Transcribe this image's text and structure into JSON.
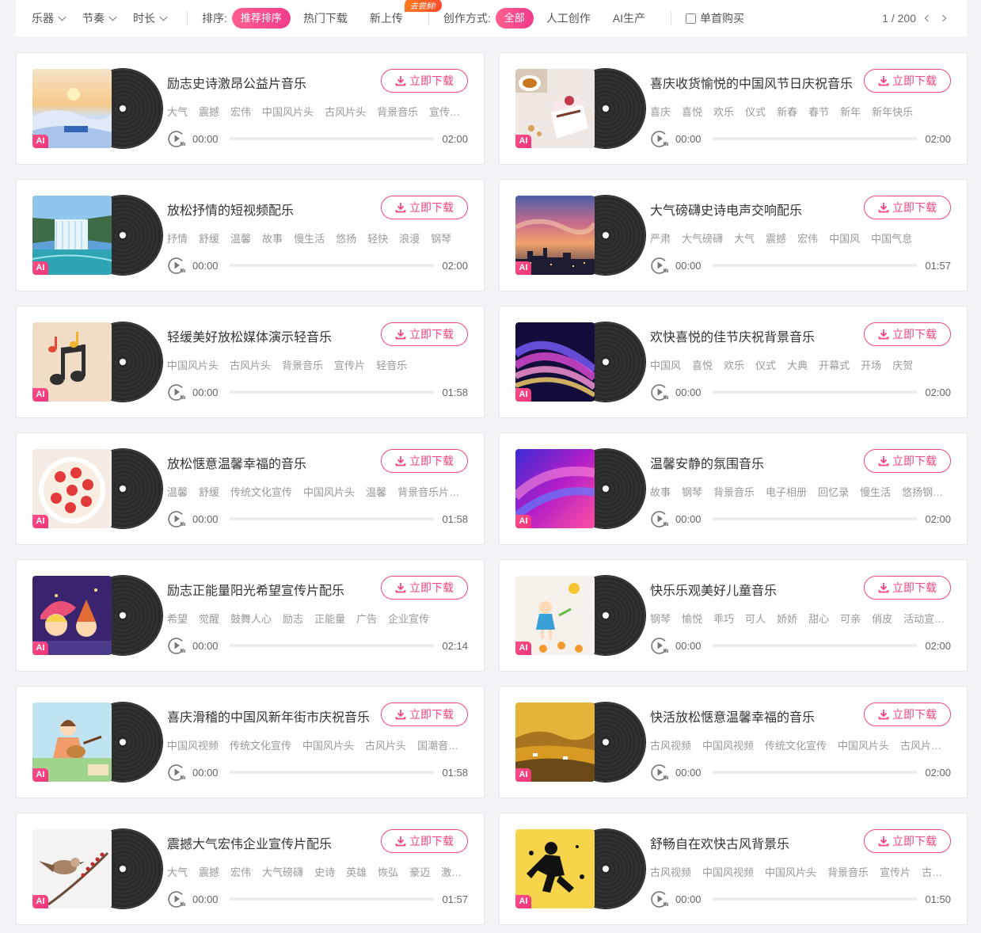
{
  "filters": {
    "dropdowns": [
      "乐器",
      "节奏",
      "时长"
    ],
    "sort_label": "排序:",
    "sort_options": [
      {
        "label": "推荐排序",
        "active": true
      },
      {
        "label": "热门下载",
        "active": false
      },
      {
        "label": "新上传",
        "active": false,
        "badge": "去尝鲜!"
      }
    ],
    "mode_label": "创作方式:",
    "mode_options": [
      {
        "label": "全部",
        "active": true
      },
      {
        "label": "人工创作",
        "active": false
      },
      {
        "label": "AI生产",
        "active": false
      }
    ],
    "single_buy_label": "单首购买",
    "page_indicator": "1 / 200"
  },
  "download_label": "立即下载",
  "ai_badge": "AI",
  "accent_color": "#f2457f",
  "tracks": [
    {
      "title": "励志史诗激昂公益片音乐",
      "tags": [
        "大气",
        "震撼",
        "宏伟",
        "中国风片头",
        "古风片头",
        "背景音乐",
        "宣传片"
      ],
      "current": "00:00",
      "duration": "02:00",
      "art": "winter-sunrise"
    },
    {
      "title": "喜庆收货愉悦的中国风节日庆祝音乐",
      "tags": [
        "喜庆",
        "喜悦",
        "欢乐",
        "仪式",
        "新春",
        "春节",
        "新年",
        "新年快乐"
      ],
      "current": "00:00",
      "duration": "02:00",
      "art": "cake-tea"
    },
    {
      "title": "放松抒情的短视频配乐",
      "tags": [
        "抒情",
        "舒缓",
        "温馨",
        "故事",
        "慢生活",
        "悠扬",
        "轻快",
        "浪漫",
        "钢琴"
      ],
      "current": "00:00",
      "duration": "02:00",
      "art": "waterfall"
    },
    {
      "title": "大气磅礴史诗电声交响配乐",
      "tags": [
        "严肃",
        "大气磅礴",
        "大气",
        "震撼",
        "宏伟",
        "中国风",
        "中国气息"
      ],
      "current": "00:00",
      "duration": "01:57",
      "art": "sunset-city"
    },
    {
      "title": "轻缓美好放松媒体演示轻音乐",
      "tags": [
        "中国风片头",
        "古风片头",
        "背景音乐",
        "宣传片",
        "轻音乐"
      ],
      "current": "00:00",
      "duration": "01:58",
      "art": "music-notes"
    },
    {
      "title": "欢快喜悦的佳节庆祝背景音乐",
      "tags": [
        "中国风",
        "喜悦",
        "欢乐",
        "仪式",
        "大典",
        "开幕式",
        "开场",
        "庆贺"
      ],
      "current": "00:00",
      "duration": "02:00",
      "art": "neon-waves"
    },
    {
      "title": "放松惬意温馨幸福的音乐",
      "tags": [
        "温馨",
        "舒缓",
        "传统文化宣传",
        "中国风片头",
        "温馨",
        "背景音乐片头"
      ],
      "current": "00:00",
      "duration": "01:58",
      "art": "strawberry-cake"
    },
    {
      "title": "温馨安静的氛围音乐",
      "tags": [
        "故事",
        "钢琴",
        "背景音乐",
        "电子相册",
        "回忆录",
        "慢生活",
        "悠扬钢琴"
      ],
      "current": "00:00",
      "duration": "02:00",
      "art": "purple-swirl"
    },
    {
      "title": "励志正能量阳光希望宣传片配乐",
      "tags": [
        "希望",
        "觉醒",
        "鼓舞人心",
        "励志",
        "正能量",
        "广告",
        "企业宣传"
      ],
      "current": "00:00",
      "duration": "02:14",
      "art": "cartoon-kids"
    },
    {
      "title": "快乐乐观美好儿童音乐",
      "tags": [
        "钢琴",
        "愉悦",
        "乖巧",
        "可人",
        "娇娇",
        "甜心",
        "可亲",
        "俏皮",
        "活动宣传"
      ],
      "current": "00:00",
      "duration": "02:00",
      "art": "girl-flowers"
    },
    {
      "title": "喜庆滑稽的中国风新年街市庆祝音乐",
      "tags": [
        "中国风视频",
        "传统文化宣传",
        "中国风片头",
        "古风片头",
        "国潮音乐"
      ],
      "current": "00:00",
      "duration": "01:58",
      "art": "guitar-girl"
    },
    {
      "title": "快活放松惬意温馨幸福的音乐",
      "tags": [
        "古风视频",
        "中国风视频",
        "传统文化宣传",
        "中国风片头",
        "古风片头"
      ],
      "current": "00:00",
      "duration": "02:00",
      "art": "golden-prairie"
    },
    {
      "title": "震撼大气宏伟企业宣传片配乐",
      "tags": [
        "大气",
        "震撼",
        "宏伟",
        "大气磅礴",
        "史诗",
        "英雄",
        "恢弘",
        "豪迈",
        "激昂"
      ],
      "current": "00:00",
      "duration": "01:57",
      "art": "bird-branch"
    },
    {
      "title": "舒畅自在欢快古风背景乐",
      "tags": [
        "古风视频",
        "中国风视频",
        "中国风片头",
        "背景音乐",
        "宣传片",
        "古风"
      ],
      "current": "00:00",
      "duration": "01:50",
      "art": "ink-runner"
    }
  ]
}
